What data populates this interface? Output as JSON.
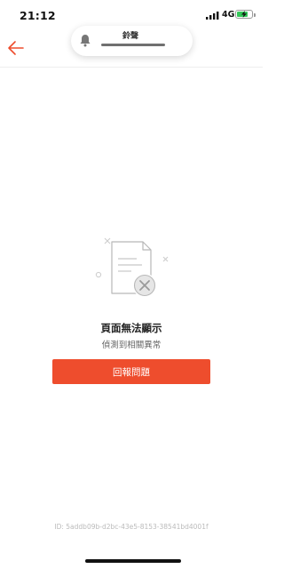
{
  "status_bar": {
    "time": "21:12",
    "network": "4G",
    "battery_level": 0.75,
    "battery_charging": true
  },
  "ringer": {
    "label": "鈴聲",
    "icon": "bell-icon"
  },
  "header": {
    "back_icon": "arrow-left-icon",
    "accent_color": "#ee4d2d"
  },
  "error": {
    "title": "頁面無法顯示",
    "subtitle": "偵測到相關異常",
    "report_button": "回報問題",
    "id_text": "ID: 5addb09b-d2bc-43e5-8153-38541bd4001f",
    "icon": "document-error-icon"
  },
  "colors": {
    "primary": "#ee4d2d",
    "battery": "#34c759"
  }
}
